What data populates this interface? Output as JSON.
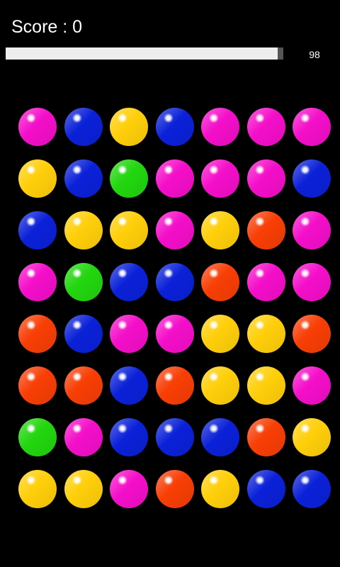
{
  "header": {
    "score_text": "Score : 0",
    "timer_value": "98"
  },
  "timer": {
    "fraction": 0.98
  },
  "colors": {
    "magenta": "#f40ec9",
    "blue": "#0b21d8",
    "yellow": "#ffcf0a",
    "green": "#22d60e",
    "orange": "#f83e05"
  },
  "board": {
    "rows": [
      [
        "magenta",
        "blue",
        "yellow",
        "blue",
        "magenta",
        "magenta",
        "magenta"
      ],
      [
        "yellow",
        "blue",
        "green",
        "magenta",
        "magenta",
        "magenta",
        "blue"
      ],
      [
        "blue",
        "yellow",
        "yellow",
        "magenta",
        "yellow",
        "orange",
        "magenta"
      ],
      [
        "magenta",
        "green",
        "blue",
        "blue",
        "orange",
        "magenta",
        "magenta"
      ],
      [
        "orange",
        "blue",
        "magenta",
        "magenta",
        "yellow",
        "yellow",
        "orange"
      ],
      [
        "orange",
        "orange",
        "blue",
        "orange",
        "yellow",
        "yellow",
        "magenta"
      ],
      [
        "green",
        "magenta",
        "blue",
        "blue",
        "blue",
        "orange",
        "yellow"
      ],
      [
        "yellow",
        "yellow",
        "magenta",
        "orange",
        "yellow",
        "blue",
        "blue"
      ]
    ]
  }
}
